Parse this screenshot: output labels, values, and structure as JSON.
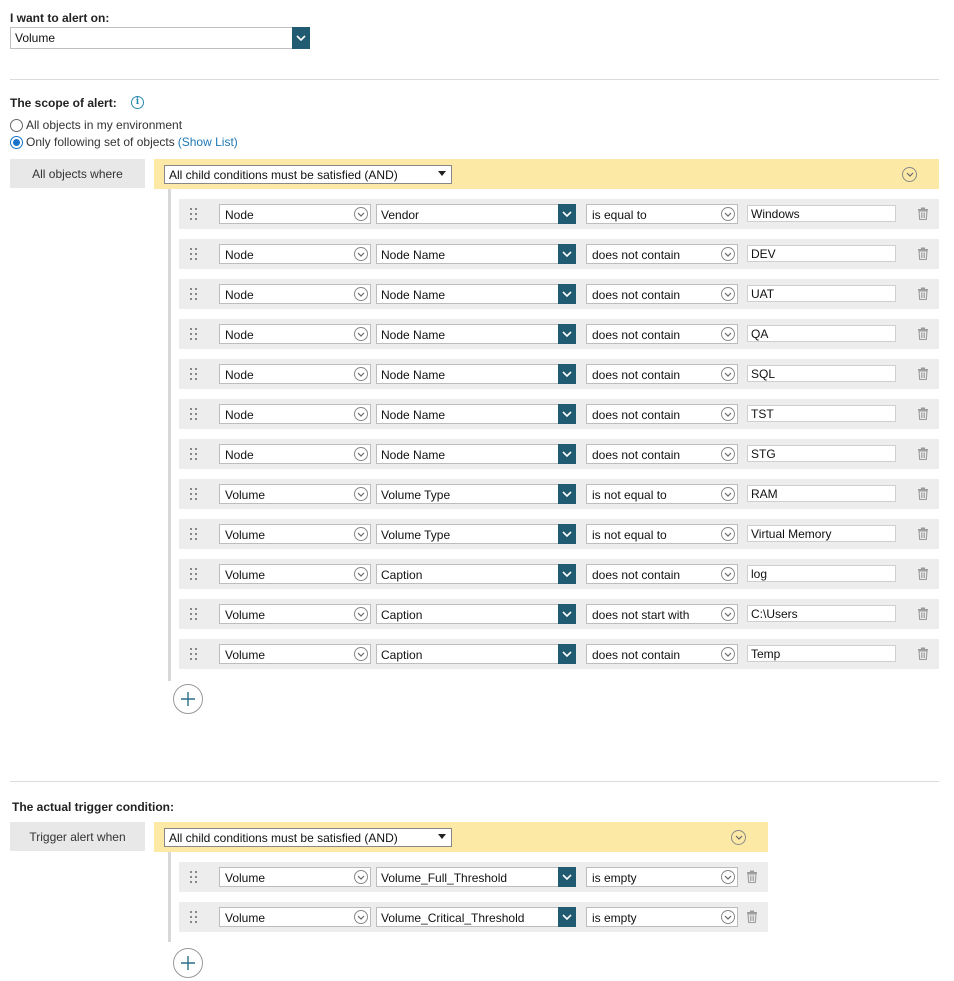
{
  "alert_on": {
    "label": "I want to alert on:",
    "value": "Volume"
  },
  "scope": {
    "label": "The scope of alert:",
    "option_all": "All objects in my environment",
    "option_set": "Only following set of objects",
    "show_list": "(Show List)",
    "side_label": "All objects where",
    "group_condition": "All child conditions must be satisfied (AND)",
    "conditions": [
      {
        "object": "Node",
        "field": "Vendor",
        "operator": "is equal to",
        "value": "Windows"
      },
      {
        "object": "Node",
        "field": "Node Name",
        "operator": "does not contain",
        "value": "DEV"
      },
      {
        "object": "Node",
        "field": "Node Name",
        "operator": "does not contain",
        "value": "UAT"
      },
      {
        "object": "Node",
        "field": "Node Name",
        "operator": "does not contain",
        "value": "QA"
      },
      {
        "object": "Node",
        "field": "Node Name",
        "operator": "does not contain",
        "value": "SQL"
      },
      {
        "object": "Node",
        "field": "Node Name",
        "operator": "does not contain",
        "value": "TST"
      },
      {
        "object": "Node",
        "field": "Node Name",
        "operator": "does not contain",
        "value": "STG"
      },
      {
        "object": "Volume",
        "field": "Volume Type",
        "operator": "is not equal to",
        "value": "RAM"
      },
      {
        "object": "Volume",
        "field": "Volume Type",
        "operator": "is not equal to",
        "value": "Virtual Memory"
      },
      {
        "object": "Volume",
        "field": "Caption",
        "operator": "does not contain",
        "value": "log"
      },
      {
        "object": "Volume",
        "field": "Caption",
        "operator": "does not start with",
        "value": "C:\\Users"
      },
      {
        "object": "Volume",
        "field": "Caption",
        "operator": "does not contain",
        "value": "Temp"
      }
    ]
  },
  "trigger": {
    "label": "The actual trigger condition:",
    "side_label": "Trigger alert when",
    "group_condition": "All child conditions must be satisfied (AND)",
    "conditions": [
      {
        "object": "Volume",
        "field": "Volume_Full_Threshold",
        "operator": "is empty"
      },
      {
        "object": "Volume",
        "field": "Volume_Critical_Threshold",
        "operator": "is empty"
      }
    ]
  },
  "colors": {
    "accent": "#215b71",
    "group_header": "#fde9a6",
    "row_bg": "#ededed",
    "link": "#1f78b4"
  },
  "icons": [
    "info-icon",
    "chevron-down-icon",
    "drag-handle-icon",
    "trash-icon",
    "add-icon",
    "collapse-icon"
  ]
}
